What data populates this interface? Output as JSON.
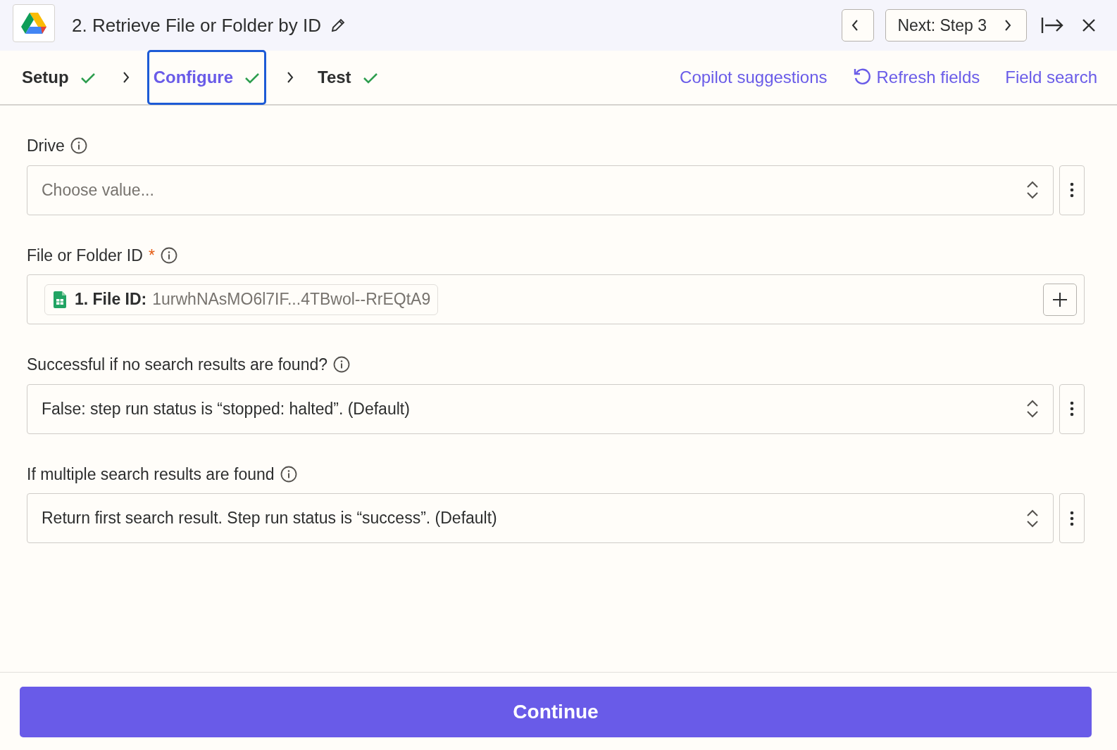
{
  "header": {
    "title": "2. Retrieve File or Folder by ID",
    "next_button": "Next: Step 3"
  },
  "steps": [
    {
      "label": "Setup",
      "done": true,
      "selected": false
    },
    {
      "label": "Configure",
      "done": true,
      "selected": true
    },
    {
      "label": "Test",
      "done": true,
      "selected": false
    }
  ],
  "actions": [
    {
      "label": "Copilot suggestions",
      "kind": "plain"
    },
    {
      "label": "Refresh fields",
      "kind": "refresh"
    },
    {
      "label": "Field search",
      "kind": "plain"
    }
  ],
  "fields": [
    {
      "label": "Drive",
      "kind": "select",
      "placeholder": "Choose value..."
    },
    {
      "label": "File or Folder ID",
      "required_mark": "*",
      "kind": "token",
      "token_label": "1. File ID:",
      "token_value": "1urwhNAsMO6l7IF...4TBwol--RrEQtA9"
    },
    {
      "label": "Successful if no search results are found?",
      "kind": "select",
      "value": "False: step run status is “stopped: halted”. (Default)"
    },
    {
      "label": "If multiple search results are found",
      "kind": "select",
      "value": "Return first search result. Step run status is “success”. (Default)"
    }
  ],
  "footer": {
    "button": "Continue"
  }
}
